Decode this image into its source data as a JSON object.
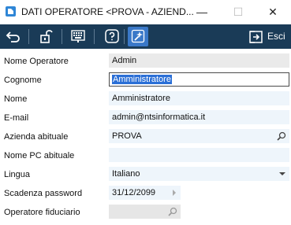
{
  "window": {
    "title": "DATI OPERATORE <PROVA - AZIEND...",
    "minimize_symbol": "—",
    "maximize_symbol": "☐",
    "close_symbol": "✕"
  },
  "toolbar": {
    "buttons": [
      {
        "name": "back-icon"
      },
      {
        "name": "unlock-icon"
      },
      {
        "name": "keyboard-icon"
      },
      {
        "name": "help-icon"
      },
      {
        "name": "magic-wand-icon",
        "active": true
      }
    ],
    "exit_label": "Esci",
    "colors": {
      "background": "#1a3b57",
      "active": "#3a78c8"
    }
  },
  "form": {
    "fields": [
      {
        "label": "Nome Operatore",
        "value": "Admin"
      },
      {
        "label": "Cognome",
        "value": "Amministratore"
      },
      {
        "label": "Nome",
        "value": "Amministratore"
      },
      {
        "label": "E-mail",
        "value": "admin@ntsinformatica.it"
      },
      {
        "label": "Azienda abituale",
        "value": "PROVA",
        "icon": "search-icon"
      },
      {
        "label": "Nome PC abituale",
        "value": ""
      },
      {
        "label": "Lingua",
        "value": "Italiano",
        "icon": "dropdown-arrow-icon"
      },
      {
        "label": "Scadenza password",
        "value": "31/12/2099",
        "icon": "calendar-arrow-icon"
      },
      {
        "label": "Operatore fiduciario",
        "value": "",
        "icon": "search-icon"
      }
    ]
  }
}
